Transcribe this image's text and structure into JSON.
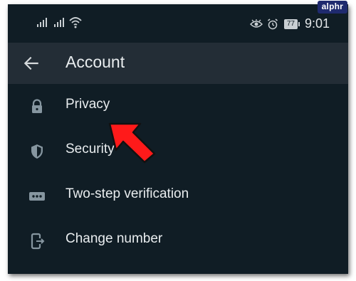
{
  "status_bar": {
    "time": "9:01",
    "battery": "77"
  },
  "watermark": "alphr",
  "header": {
    "title": "Account"
  },
  "menu": {
    "items": [
      {
        "label": "Privacy",
        "icon": "lock-icon"
      },
      {
        "label": "Security",
        "icon": "shield-icon"
      },
      {
        "label": "Two-step verification",
        "icon": "dots-icon"
      },
      {
        "label": "Change number",
        "icon": "phone-change-icon"
      }
    ]
  },
  "colors": {
    "background": "#101d25",
    "app_bar": "#232d36",
    "text": "#e9edef",
    "icon": "#8696a0",
    "annotation_arrow": "#ff1a1a"
  }
}
